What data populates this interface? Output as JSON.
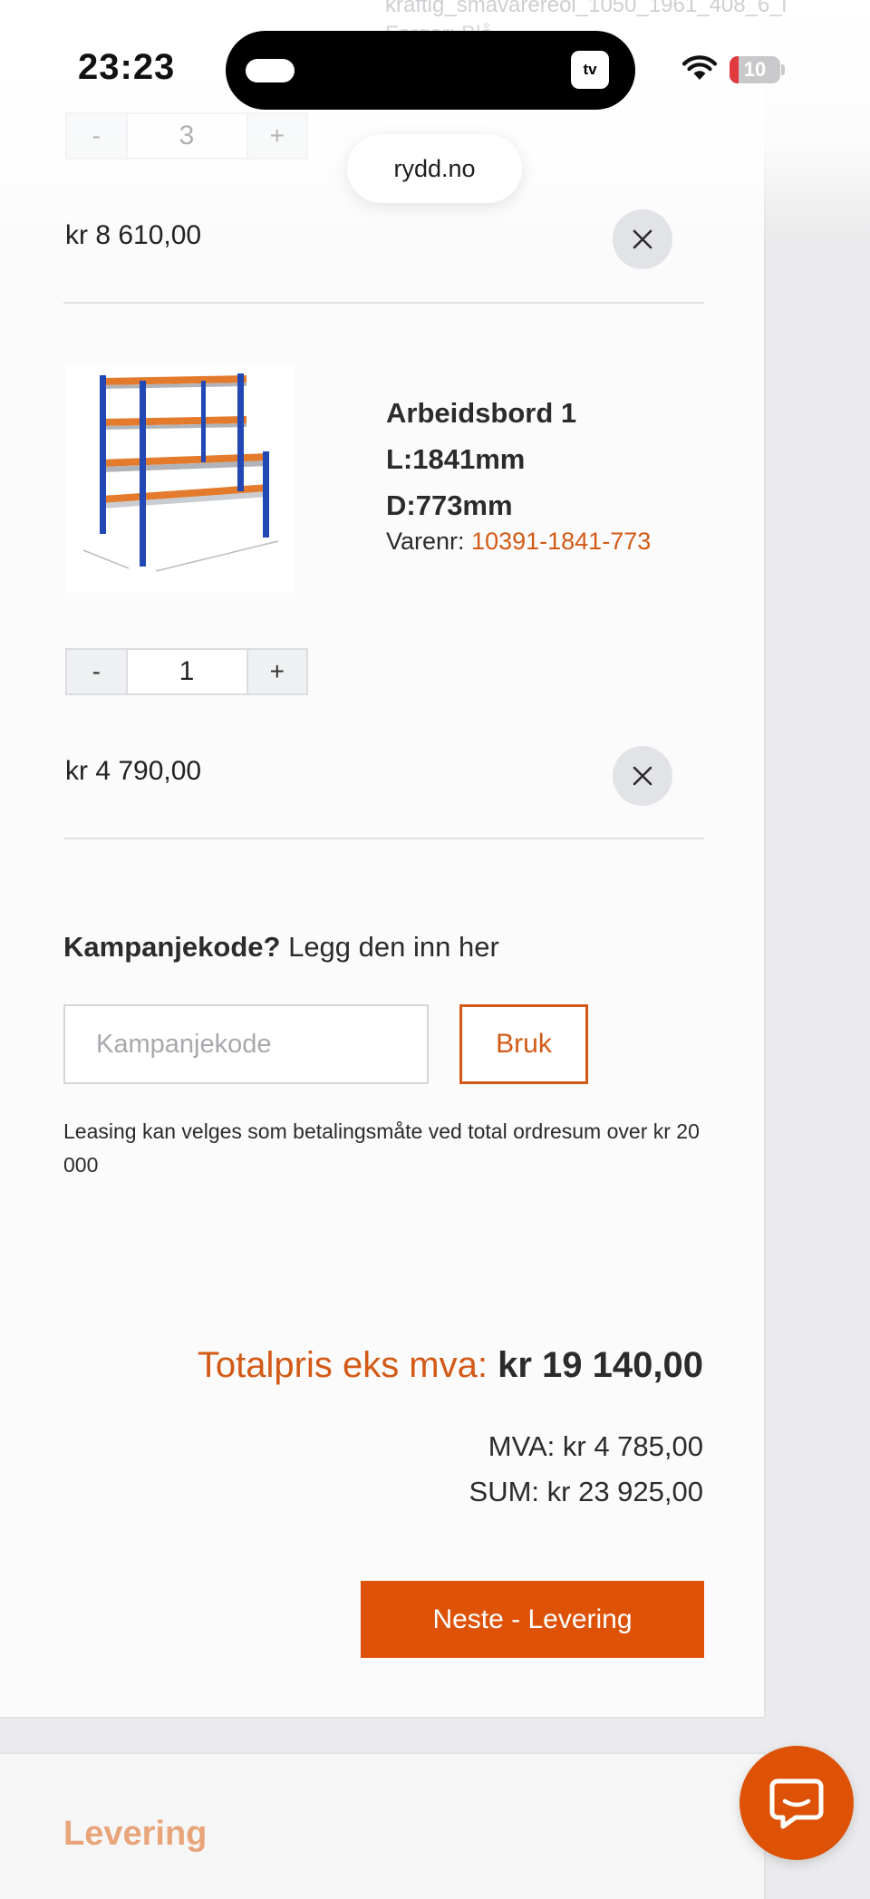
{
  "status_bar": {
    "time": "23:23",
    "battery_level": "10",
    "tv_label": "tv"
  },
  "browser": {
    "url": "rydd.no"
  },
  "background_text": {
    "line1": "kraftig_smavarereol_1050_1961_408_6_l",
    "line2": "Farger: Blå"
  },
  "cart": {
    "items": [
      {
        "quantity": "3",
        "minus_label": "-",
        "plus_label": "+",
        "price": "kr 8 610,00"
      },
      {
        "title_line1": "Arbeidsbord 1",
        "title_line2": "L:1841mm",
        "title_line3": "D:773mm",
        "varenr_label": "Varenr:",
        "varenr_code": "10391-1841-773",
        "quantity": "1",
        "minus_label": "-",
        "plus_label": "+",
        "price": "kr 4 790,00"
      }
    ]
  },
  "promo": {
    "label_bold": "Kampanjekode?",
    "label_rest": "Legg den inn her",
    "placeholder": "Kampanjekode",
    "button_label": "Bruk"
  },
  "leasing_note": "Leasing kan velges som betalingsmåte ved total ordresum over kr 20 000",
  "totals": {
    "total_label": "Totalpris eks mva:",
    "total_amount": "kr 19 140,00",
    "mva": "MVA: kr 4 785,00",
    "sum": "SUM: kr 23 925,00"
  },
  "next_button": "Neste - Levering",
  "next_section_title": "Levering",
  "colors": {
    "accent": "#dd5207",
    "link": "#d35a16"
  }
}
